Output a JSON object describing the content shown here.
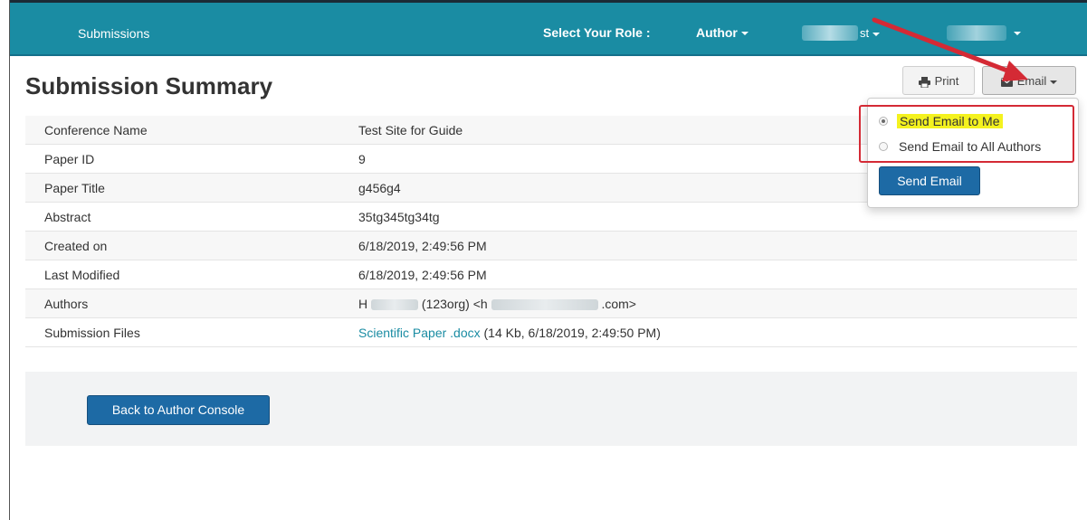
{
  "navbar": {
    "brand": "Submissions",
    "role_label": "Select Your Role :",
    "role_value": "Author",
    "user_suffix": "st"
  },
  "page": {
    "title": "Submission Summary"
  },
  "actions": {
    "print_label": "Print",
    "email_label": "Email"
  },
  "email_menu": {
    "options": [
      {
        "label": "Send Email to Me",
        "selected": true
      },
      {
        "label": "Send Email to All Authors",
        "selected": false
      }
    ],
    "send_label": "Send Email"
  },
  "summary": {
    "rows": [
      {
        "label": "Conference Name",
        "value": "Test Site for Guide"
      },
      {
        "label": "Paper ID",
        "value": "9"
      },
      {
        "label": "Paper Title",
        "value": "g456g4"
      },
      {
        "label": "Abstract",
        "value": "35tg345tg34tg"
      },
      {
        "label": "Created on",
        "value": "6/18/2019, 2:49:56 PM"
      },
      {
        "label": "Last Modified",
        "value": "6/18/2019, 2:49:56 PM"
      },
      {
        "label": "Authors",
        "value_prefix": "H",
        "value_org": "(123org) <h",
        "value_suffix": ".com>"
      },
      {
        "label": "Submission Files",
        "file_name": "Scientific Paper .docx",
        "file_meta": "(14 Kb, 6/18/2019, 2:49:50 PM)"
      }
    ]
  },
  "footer": {
    "back_label": "Back to Author Console"
  },
  "colors": {
    "navbar": "#1a8ca3",
    "primary_button": "#1d6aa5",
    "highlight": "#f4f21f",
    "annotation_red": "#d42a35"
  }
}
